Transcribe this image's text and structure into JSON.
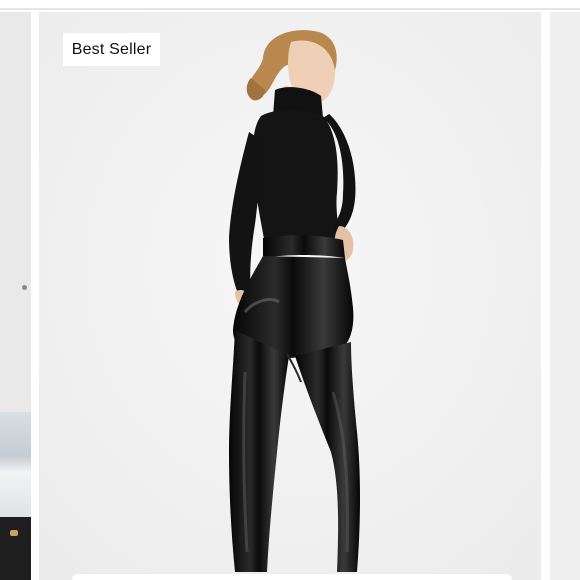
{
  "carousel": {
    "current_slide": {
      "badge_label": "Best Seller",
      "image_icon": "model-photo"
    }
  },
  "colors": {
    "card_background": "#f3f3f3",
    "badge_background": "#ffffff",
    "garment": "#0b0b0b"
  }
}
